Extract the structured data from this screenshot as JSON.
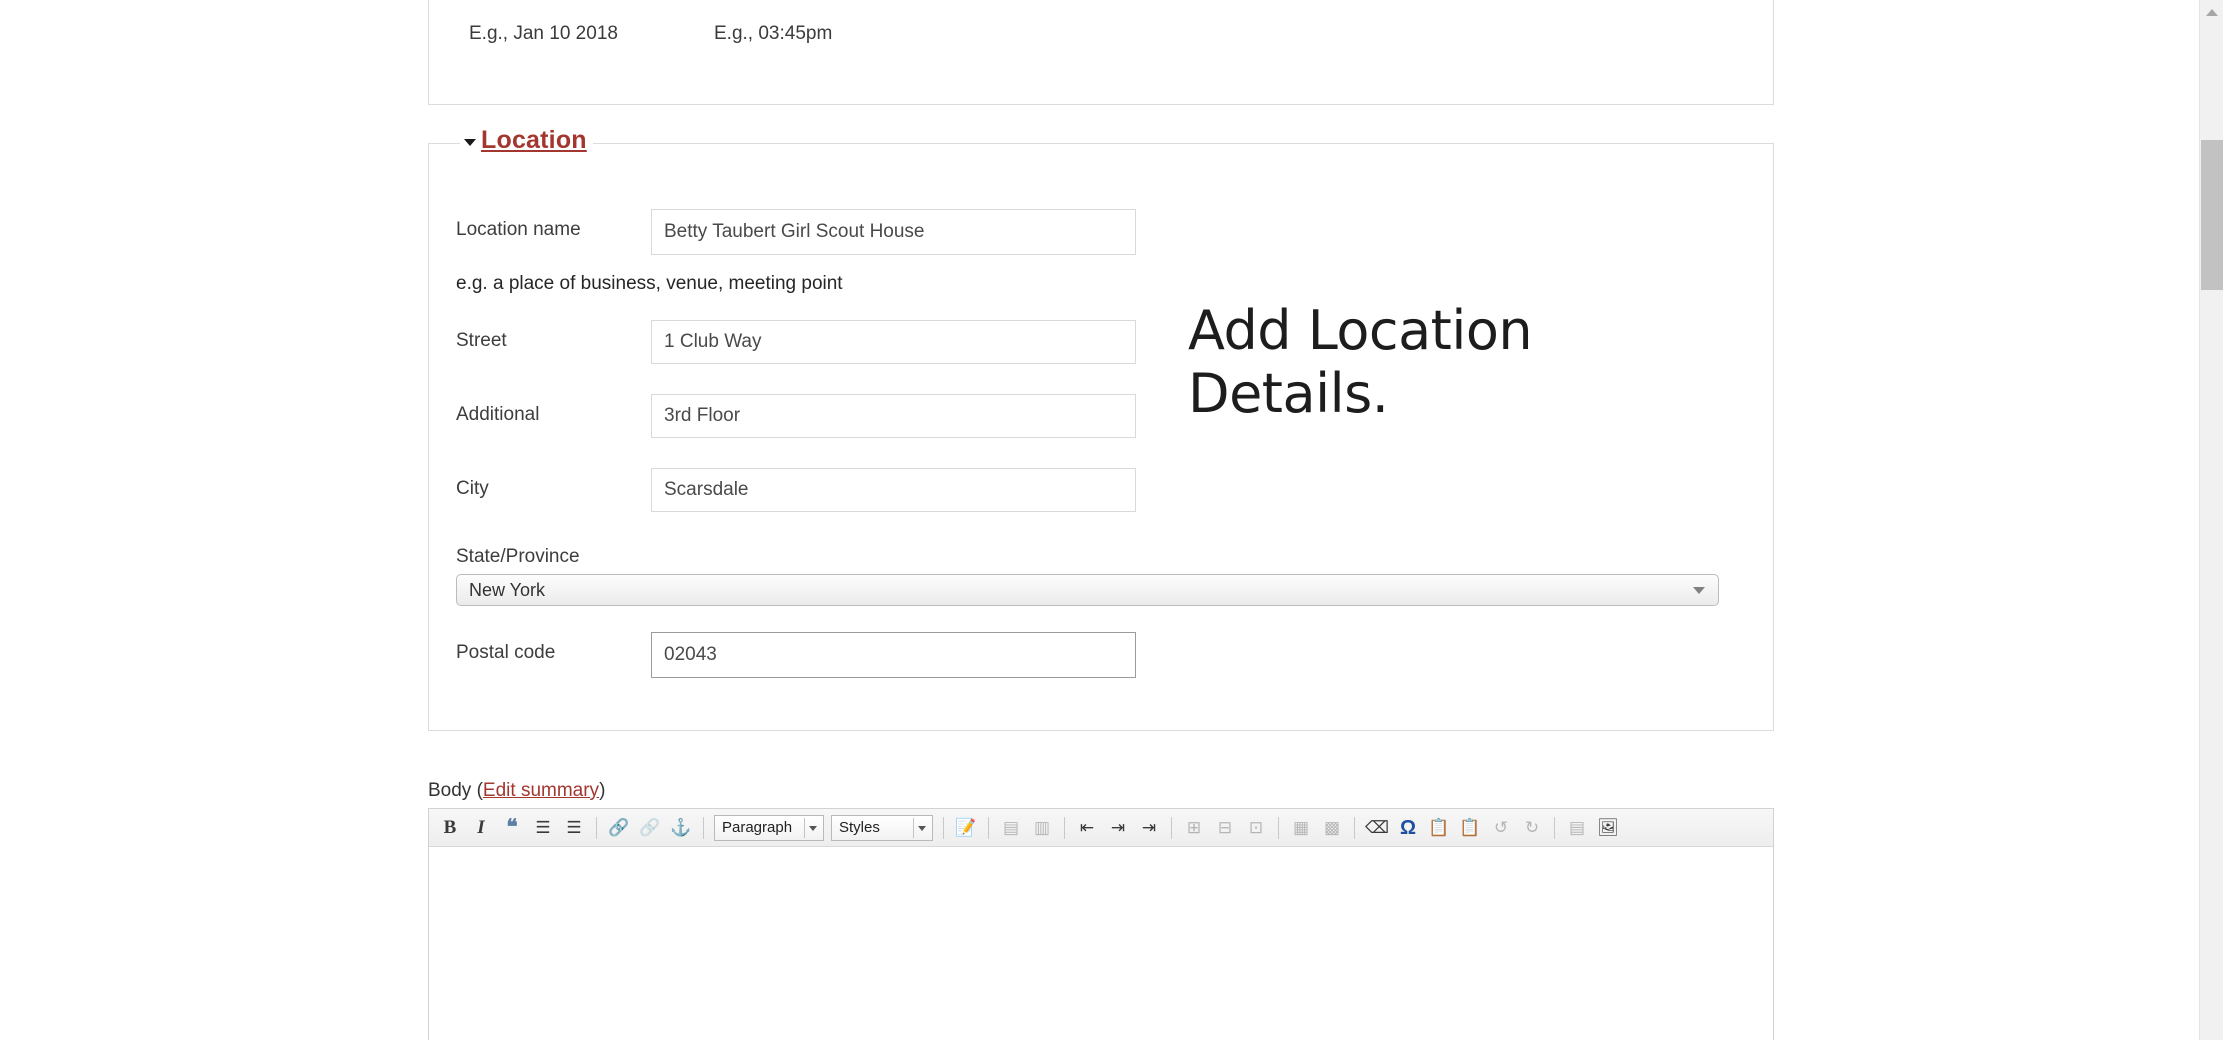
{
  "datetime_panel": {
    "date_example": "E.g., Jan 10 2018",
    "time_example": "E.g., 03:45pm"
  },
  "location": {
    "legend": "Location",
    "legend_color": "#a3372f",
    "collapse_icon": "triangle-down-icon",
    "fields": {
      "location_name": {
        "label": "Location name",
        "value": "Betty Taubert Girl Scout House",
        "placeholder": "",
        "help": "e.g. a place of business, venue, meeting point"
      },
      "street": {
        "label": "Street",
        "value": "1 Club Way",
        "placeholder": ""
      },
      "additional": {
        "label": "Additional",
        "value": "3rd Floor",
        "placeholder": ""
      },
      "city": {
        "label": "City",
        "value": "Scarsdale",
        "placeholder": ""
      },
      "state": {
        "label": "State/Province",
        "value": "New York"
      },
      "postal": {
        "label": "Postal code",
        "value": "02043",
        "placeholder": ""
      }
    }
  },
  "annotation": {
    "text": "Add Location\nDetails."
  },
  "body_section": {
    "label_prefix": "Body (",
    "edit_summary_link": "Edit summary",
    "label_suffix": ")"
  },
  "editor_toolbar": {
    "buttons": [
      {
        "name": "bold-icon",
        "glyph": "B",
        "style": "glyph-bold",
        "disabled": false
      },
      {
        "name": "italic-icon",
        "glyph": "I",
        "style": "glyph-ital",
        "disabled": false
      },
      {
        "name": "blockquote-icon",
        "glyph": "❝",
        "style": "glyph-quote",
        "disabled": false
      },
      {
        "name": "bulleted-list-icon",
        "glyph": "☰",
        "style": "",
        "disabled": false
      },
      {
        "name": "numbered-list-icon",
        "glyph": "☰",
        "style": "",
        "disabled": false
      },
      {
        "name": "link-icon",
        "glyph": "🔗",
        "style": "",
        "disabled": false
      },
      {
        "name": "unlink-icon",
        "glyph": "🔗",
        "style": "",
        "disabled": true
      },
      {
        "name": "anchor-icon",
        "glyph": "⚓",
        "style": "",
        "disabled": false
      },
      {
        "name": "templates-icon",
        "glyph": "📝",
        "style": "",
        "disabled": false
      },
      {
        "name": "table-row-icon",
        "glyph": "▤",
        "style": "",
        "disabled": true
      },
      {
        "name": "table-column-icon",
        "glyph": "▥",
        "style": "",
        "disabled": true
      },
      {
        "name": "outdent-icon",
        "glyph": "⇤",
        "style": "",
        "disabled": false
      },
      {
        "name": "indent-icon",
        "glyph": "⇥",
        "style": "",
        "disabled": false
      },
      {
        "name": "blockindent-icon",
        "glyph": "⇥",
        "style": "",
        "disabled": false
      },
      {
        "name": "cell-merge-icon",
        "glyph": "⊞",
        "style": "",
        "disabled": true
      },
      {
        "name": "cell-split-icon",
        "glyph": "⊟",
        "style": "",
        "disabled": true
      },
      {
        "name": "cell-props-icon",
        "glyph": "⊡",
        "style": "",
        "disabled": true
      },
      {
        "name": "table-icon",
        "glyph": "▦",
        "style": "",
        "disabled": true
      },
      {
        "name": "table-properties-icon",
        "glyph": "▩",
        "style": "",
        "disabled": true
      },
      {
        "name": "remove-format-icon",
        "glyph": "⌫",
        "style": "",
        "disabled": false
      },
      {
        "name": "special-character-icon",
        "glyph": "Ω",
        "style": "glyph-omega",
        "disabled": false
      },
      {
        "name": "paste-as-text-icon",
        "glyph": "📋",
        "style": "",
        "disabled": false
      },
      {
        "name": "paste-from-word-icon",
        "glyph": "📋",
        "style": "",
        "disabled": false
      },
      {
        "name": "undo-icon",
        "glyph": "↺",
        "style": "",
        "disabled": true
      },
      {
        "name": "redo-icon",
        "glyph": "↻",
        "style": "",
        "disabled": true
      },
      {
        "name": "show-blocks-icon",
        "glyph": "▤",
        "style": "",
        "disabled": true
      },
      {
        "name": "image-icon",
        "glyph": "🖼",
        "style": "",
        "disabled": false
      }
    ],
    "format_select": "Paragraph",
    "styles_select": "Styles",
    "content": ""
  },
  "scrollbar": {
    "up_arrow_icon": "chevron-up-icon"
  }
}
